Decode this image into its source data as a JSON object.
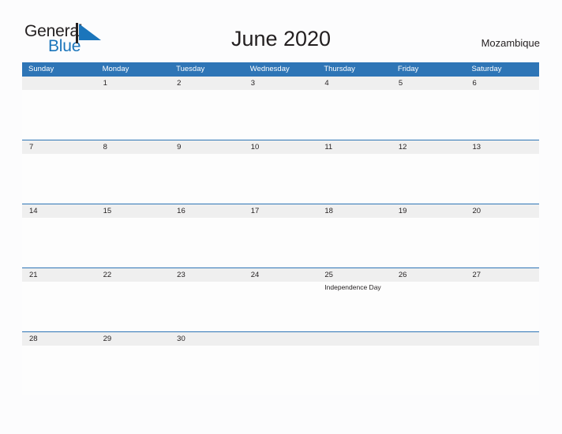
{
  "brand": {
    "name_part1": "General",
    "name_part2": "Blue",
    "flag_icon": "blue-flag-triangle-icon",
    "color_dark": "#231f20",
    "color_blue": "#1b75bb"
  },
  "header": {
    "title": "June 2020",
    "country": "Mozambique"
  },
  "theme": {
    "header_blue": "#2e75b6",
    "row_divider_blue": "#2e75b6",
    "date_strip_gray": "#efefef",
    "cell_white": "#fdfdfd",
    "page_background": "#fcfcfd",
    "text": "#231f20"
  },
  "calendar": {
    "month": "June",
    "year": "2020",
    "weekday_headers": [
      "Sunday",
      "Monday",
      "Tuesday",
      "Wednesday",
      "Thursday",
      "Friday",
      "Saturday"
    ],
    "weeks": [
      [
        {
          "number": "",
          "event": ""
        },
        {
          "number": "1",
          "event": ""
        },
        {
          "number": "2",
          "event": ""
        },
        {
          "number": "3",
          "event": ""
        },
        {
          "number": "4",
          "event": ""
        },
        {
          "number": "5",
          "event": ""
        },
        {
          "number": "6",
          "event": ""
        }
      ],
      [
        {
          "number": "7",
          "event": ""
        },
        {
          "number": "8",
          "event": ""
        },
        {
          "number": "9",
          "event": ""
        },
        {
          "number": "10",
          "event": ""
        },
        {
          "number": "11",
          "event": ""
        },
        {
          "number": "12",
          "event": ""
        },
        {
          "number": "13",
          "event": ""
        }
      ],
      [
        {
          "number": "14",
          "event": ""
        },
        {
          "number": "15",
          "event": ""
        },
        {
          "number": "16",
          "event": ""
        },
        {
          "number": "17",
          "event": ""
        },
        {
          "number": "18",
          "event": ""
        },
        {
          "number": "19",
          "event": ""
        },
        {
          "number": "20",
          "event": ""
        }
      ],
      [
        {
          "number": "21",
          "event": ""
        },
        {
          "number": "22",
          "event": ""
        },
        {
          "number": "23",
          "event": ""
        },
        {
          "number": "24",
          "event": ""
        },
        {
          "number": "25",
          "event": "Independence Day"
        },
        {
          "number": "26",
          "event": ""
        },
        {
          "number": "27",
          "event": ""
        }
      ],
      [
        {
          "number": "28",
          "event": ""
        },
        {
          "number": "29",
          "event": ""
        },
        {
          "number": "30",
          "event": ""
        },
        {
          "number": "",
          "event": ""
        },
        {
          "number": "",
          "event": ""
        },
        {
          "number": "",
          "event": ""
        },
        {
          "number": "",
          "event": ""
        }
      ]
    ]
  }
}
